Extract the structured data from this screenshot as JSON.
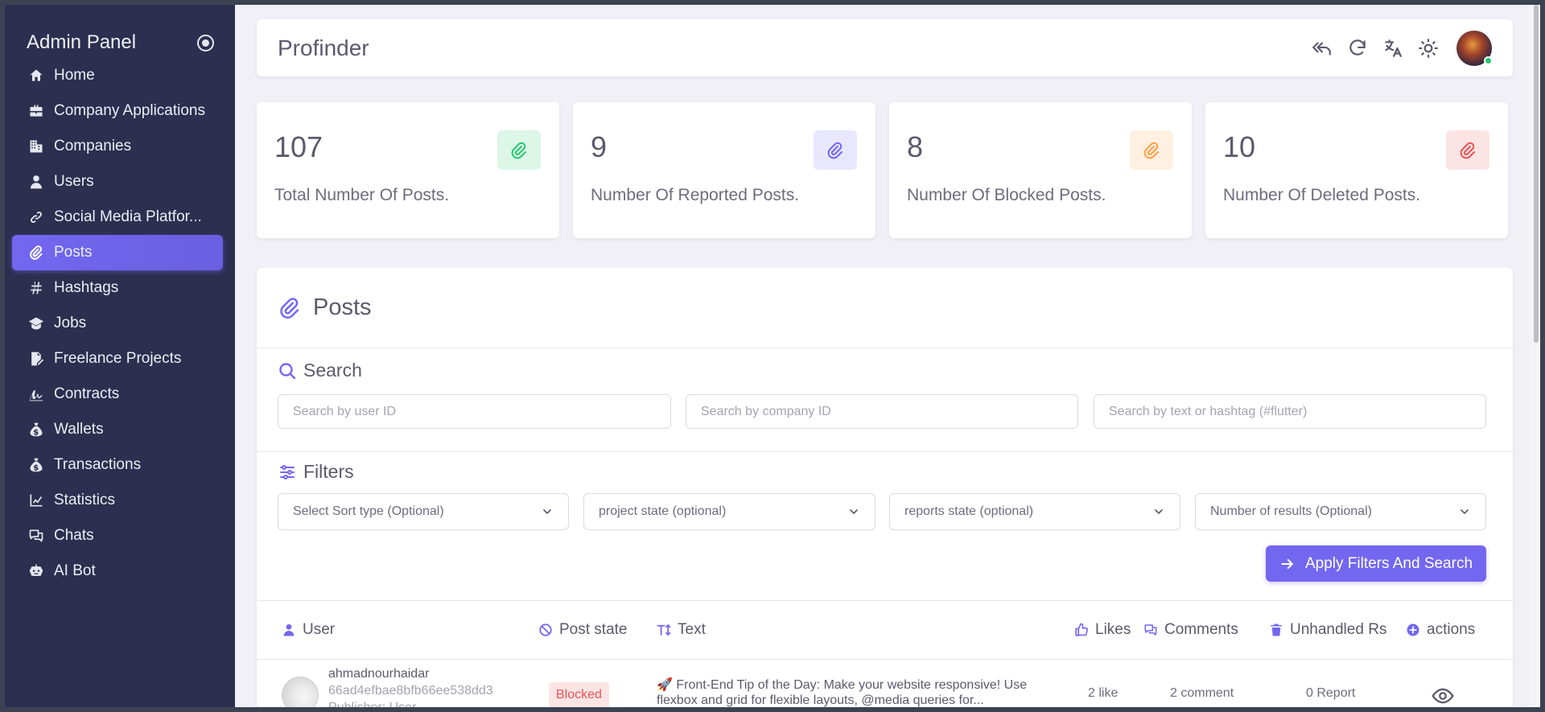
{
  "sidebar": {
    "title": "Admin Panel",
    "items": [
      {
        "label": "Home",
        "icon": "home-icon"
      },
      {
        "label": "Company Applications",
        "icon": "briefcase-icon"
      },
      {
        "label": "Companies",
        "icon": "building-icon"
      },
      {
        "label": "Users",
        "icon": "user-icon"
      },
      {
        "label": "Social Media Platfor...",
        "icon": "link-icon"
      },
      {
        "label": "Posts",
        "icon": "paperclip-icon",
        "active": true
      },
      {
        "label": "Hashtags",
        "icon": "hashtag-icon"
      },
      {
        "label": "Jobs",
        "icon": "graduation-cap-icon"
      },
      {
        "label": "Freelance Projects",
        "icon": "file-edit-icon"
      },
      {
        "label": "Contracts",
        "icon": "signature-icon"
      },
      {
        "label": "Wallets",
        "icon": "money-bag-icon"
      },
      {
        "label": "Transactions",
        "icon": "money-bag-icon"
      },
      {
        "label": "Statistics",
        "icon": "chart-line-icon"
      },
      {
        "label": "Chats",
        "icon": "chat-icon"
      },
      {
        "label": "AI Bot",
        "icon": "robot-icon"
      }
    ]
  },
  "topbar": {
    "title": "Profinder",
    "icons": [
      "reply-all-icon",
      "refresh-icon",
      "translate-icon",
      "sun-icon"
    ]
  },
  "stats": [
    {
      "value": "107",
      "label": "Total Number Of Posts.",
      "color": "#28c76f",
      "bg": "#dcf6e8"
    },
    {
      "value": "9",
      "label": "Number Of Reported Posts.",
      "color": "#7367f0",
      "bg": "#e8e7fd"
    },
    {
      "value": "8",
      "label": "Number Of Blocked Posts.",
      "color": "#ff9f43",
      "bg": "#fff0e1"
    },
    {
      "value": "10",
      "label": "Number Of Deleted Posts.",
      "color": "#ea5455",
      "bg": "#fce4e4"
    }
  ],
  "posts": {
    "title": "Posts",
    "search": {
      "title": "Search",
      "user_placeholder": "Search by user ID",
      "company_placeholder": "Search by company ID",
      "text_placeholder": "Search by text or hashtag (#flutter)"
    },
    "filters": {
      "title": "Filters",
      "sort": "Select Sort type (Optional)",
      "project_state": "project state (optional)",
      "reports_state": "reports state (optional)",
      "results": "Number of results (Optional)",
      "apply_label": "Apply Filters And Search"
    },
    "columns": {
      "user": "User",
      "post_state": "Post state",
      "text": "Text",
      "likes": "Likes",
      "comments": "Comments",
      "unhandled": "Unhandled Rs",
      "actions": "actions"
    },
    "rows": [
      {
        "username": "ahmadnourhaidar",
        "user_id": "66ad4efbae8bfb66ee538dd3",
        "publisher": "Publisher: User",
        "state": "Blocked",
        "text_line1": "🚀 Front-End Tip of the Day: Make your website responsive! Use",
        "text_line2": "flexbox and grid for flexible layouts, @media queries for...",
        "likes": "2 like",
        "comments": "2 comment",
        "reports": "0 Report"
      }
    ]
  },
  "colors": {
    "accent": "#7367f0",
    "sidebar_bg": "#2c2f4f"
  }
}
